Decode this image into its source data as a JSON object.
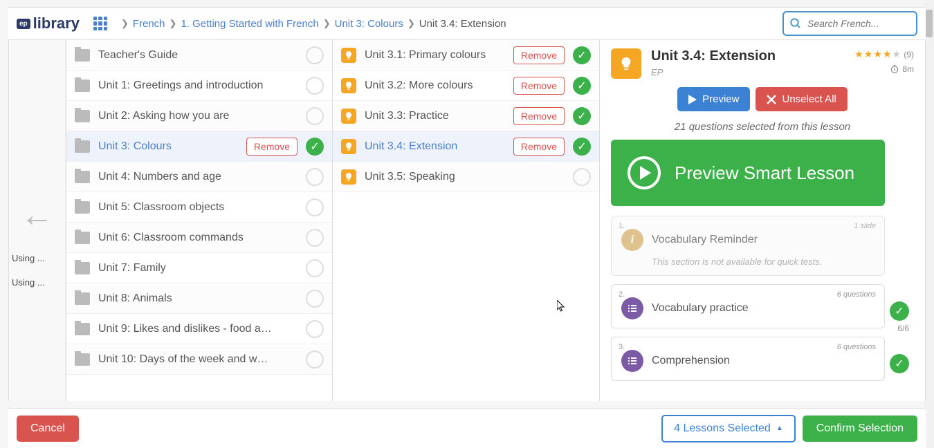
{
  "logo": {
    "badge": "ep",
    "text": "library"
  },
  "breadcrumb": [
    {
      "label": "French",
      "link": true
    },
    {
      "label": "1. Getting Started with French",
      "link": true
    },
    {
      "label": "Unit 3: Colours",
      "link": true
    },
    {
      "label": "Unit 3.4: Extension",
      "link": false
    }
  ],
  "search": {
    "placeholder": "Search French..."
  },
  "bg_left": {
    "items": [
      "Using ...",
      "Using ..."
    ]
  },
  "col1": [
    {
      "label": "Teacher's Guide",
      "selected": false,
      "remove": false
    },
    {
      "label": "Unit 1: Greetings and introduction",
      "selected": false,
      "remove": false
    },
    {
      "label": "Unit 2: Asking how you are",
      "selected": false,
      "remove": false
    },
    {
      "label": "Unit 3: Colours",
      "selected": true,
      "remove": true
    },
    {
      "label": "Unit 4: Numbers and age",
      "selected": false,
      "remove": false
    },
    {
      "label": "Unit 5: Classroom objects",
      "selected": false,
      "remove": false
    },
    {
      "label": "Unit 6: Classroom commands",
      "selected": false,
      "remove": false
    },
    {
      "label": "Unit 7: Family",
      "selected": false,
      "remove": false
    },
    {
      "label": "Unit 8: Animals",
      "selected": false,
      "remove": false
    },
    {
      "label": "Unit 9: Likes and dislikes - food a…",
      "selected": false,
      "remove": false
    },
    {
      "label": "Unit 10: Days of the week and w…",
      "selected": false,
      "remove": false
    }
  ],
  "col2": [
    {
      "label": "Unit 3.1: Primary colours",
      "selected": false,
      "checked": true,
      "remove": true
    },
    {
      "label": "Unit 3.2: More colours",
      "selected": false,
      "checked": true,
      "remove": true
    },
    {
      "label": "Unit 3.3: Practice",
      "selected": false,
      "checked": true,
      "remove": true
    },
    {
      "label": "Unit 3.4: Extension",
      "selected": true,
      "checked": true,
      "remove": true
    },
    {
      "label": "Unit 3.5: Speaking",
      "selected": false,
      "checked": false,
      "remove": false
    }
  ],
  "remove_label": "Remove",
  "detail": {
    "title": "Unit 3.4: Extension",
    "author": "EP",
    "rating_count": "(9)",
    "time": "8m",
    "preview_label": "Preview",
    "unselect_label": "Unselect All",
    "selected_text": "21 questions selected from this lesson",
    "preview_smart": "Preview Smart Lesson",
    "sections": [
      {
        "num": "1.",
        "title": "Vocabulary Reminder",
        "meta": "1 slide",
        "icon": "info",
        "note": "This section is not available for quick tests.",
        "disabled": true
      },
      {
        "num": "2.",
        "title": "Vocabulary practice",
        "meta": "6 questions",
        "icon": "list",
        "checked": true,
        "count": "6/6"
      },
      {
        "num": "3.",
        "title": "Comprehension",
        "meta": "6 questions",
        "icon": "list",
        "checked": true
      }
    ]
  },
  "footer": {
    "cancel": "Cancel",
    "lessons": "4 Lessons Selected",
    "confirm": "Confirm Selection"
  }
}
